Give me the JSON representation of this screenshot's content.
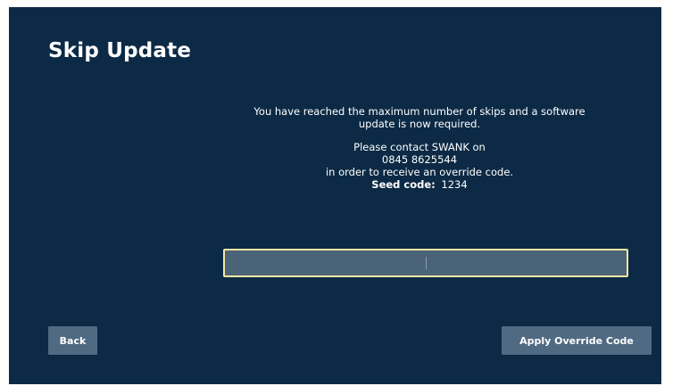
{
  "screen": {
    "title": "Skip Update"
  },
  "message": {
    "line1": "You have reached the maximum number of skips and a software",
    "line2": "update is now required.",
    "contact_line1": "Please contact SWANK on",
    "contact_phone": "0845 8625544",
    "contact_line3": "in order to receive an override code.",
    "seed_label": "Seed code:",
    "seed_value": "1234"
  },
  "override_input": {
    "value": "",
    "placeholder": ""
  },
  "buttons": {
    "back_label": "Back",
    "apply_label": "Apply Override Code"
  },
  "colors": {
    "background": "#0c2a45",
    "input_border": "#f3e8a0",
    "input_fill": "#4b6378",
    "button_fill": "#4f6a82"
  }
}
